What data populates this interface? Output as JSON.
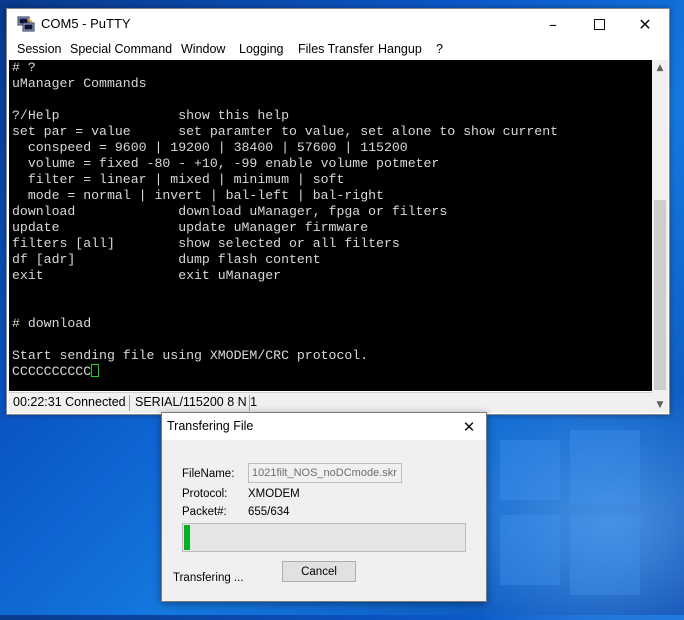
{
  "window": {
    "title": "COM5 - PuTTY",
    "icon": "putty-icon",
    "controls": [
      "minimize-icon",
      "maximize-icon",
      "close-icon"
    ]
  },
  "menu": {
    "session": "Session",
    "special_command": "Special Command",
    "window": "Window",
    "logging": "Logging",
    "files_transfer": "Files Transfer",
    "hangup": "Hangup",
    "help": "?"
  },
  "terminal": {
    "lines": [
      "# ?",
      "uManager Commands",
      "",
      "?/Help               show this help",
      "set par = value      set paramter to value, set alone to show current",
      "  conspeed = 9600 | 19200 | 38400 | 57600 | 115200",
      "  volume = fixed -80 - +10, -99 enable volume potmeter",
      "  filter = linear | mixed | minimum | soft",
      "  mode = normal | invert | bal-left | bal-right",
      "download             download uManager, fpga or filters",
      "update               update uManager firmware",
      "filters [all]        show selected or all filters",
      "df [adr]             dump flash content",
      "exit                 exit uManager",
      "",
      "",
      "# download",
      "",
      "Start sending file using XMODEM/CRC protocol."
    ],
    "last_line": "CCCCCCCCCC"
  },
  "statusbar": {
    "connected": "00:22:31 Connected",
    "serial": "SERIAL/115200 8 N 1"
  },
  "dialog": {
    "title": "Transfering File",
    "filename_label": "FileName:",
    "filename_value": "1021filt_NOS_noDCmode.skr",
    "protocol_label": "Protocol:",
    "protocol_value": "XMODEM",
    "packet_label": "Packet#:",
    "packet_value": "655/634",
    "progress_fraction": 0.03,
    "progress_color": "#06b025",
    "status_text": "Transfering ...",
    "cancel_label": "Cancel"
  }
}
